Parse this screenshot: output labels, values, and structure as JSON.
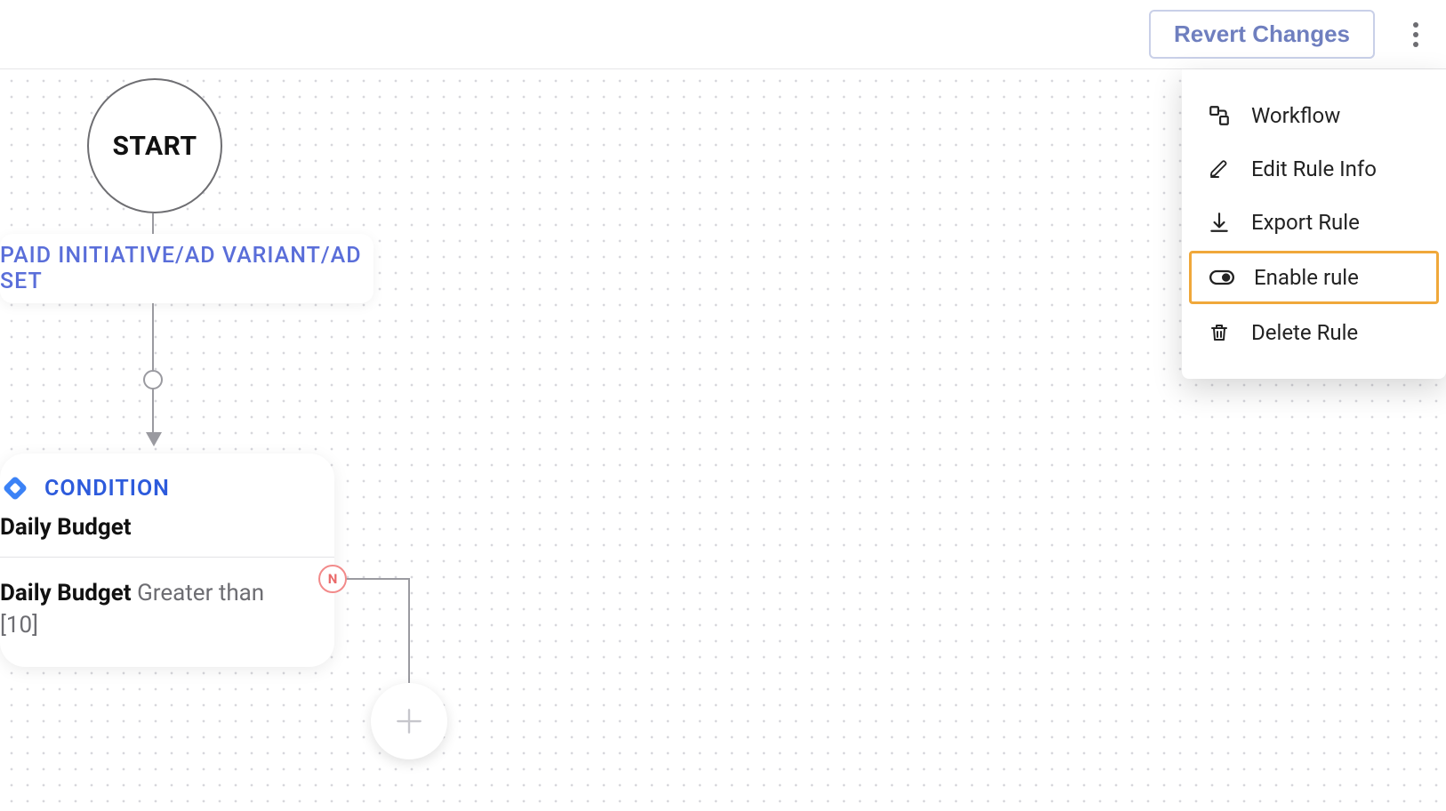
{
  "toolbar": {
    "revert_label": "Revert Changes"
  },
  "flow": {
    "start_label": "START",
    "source_label": "PAID INITIATIVE/AD VARIANT/AD SET",
    "condition": {
      "tag": "CONDITION",
      "title": "Daily Budget",
      "field": "Daily Budget",
      "operator": "Greater than",
      "value": "[10]"
    },
    "n_badge": "N"
  },
  "menu": {
    "items": [
      {
        "label": "Workflow",
        "icon": "workflow-icon"
      },
      {
        "label": "Edit Rule Info",
        "icon": "pencil-icon"
      },
      {
        "label": "Export Rule",
        "icon": "download-icon"
      },
      {
        "label": "Enable rule",
        "icon": "toggle-icon",
        "highlighted": true
      },
      {
        "label": "Delete Rule",
        "icon": "trash-icon"
      }
    ]
  }
}
